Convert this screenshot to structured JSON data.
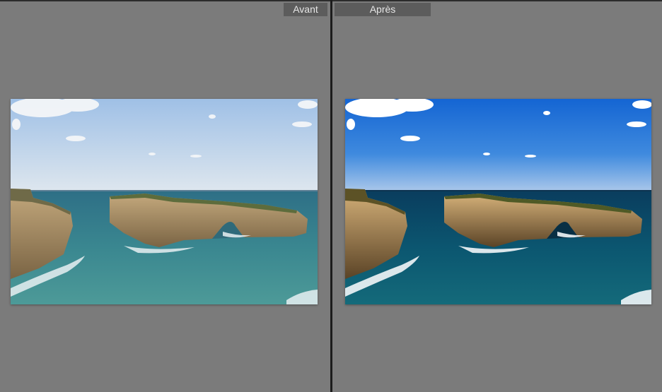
{
  "compare_view": {
    "before": {
      "label": "Avant",
      "photo_icon": "seascape-rock-arch-photo"
    },
    "after": {
      "label": "Après",
      "photo_icon": "seascape-rock-arch-photo"
    }
  },
  "colors": {
    "background": "#7b7b7b",
    "divider": "#1c1c1c",
    "label_bg": "#5c5c5c",
    "label_text": "#e6e6e6",
    "before_sky_top": "#a9c6e8",
    "before_sky_bottom": "#d9e4ef",
    "before_sea": "#3f8a93",
    "after_sky_top": "#1668d6",
    "after_sky_bottom": "#9cc0ea",
    "after_sea": "#0b4d69"
  }
}
